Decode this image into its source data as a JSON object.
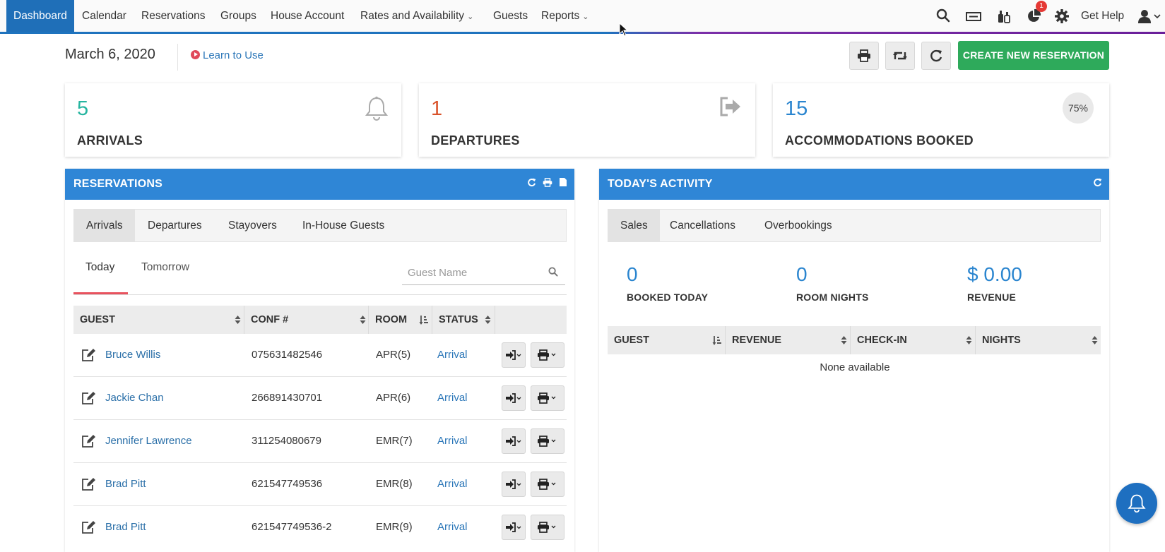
{
  "nav": {
    "items": [
      {
        "label": "Dashboard",
        "active": true
      },
      {
        "label": "Calendar"
      },
      {
        "label": "Reservations"
      },
      {
        "label": "Groups"
      },
      {
        "label": "House Account"
      },
      {
        "label": "Rates and Availability",
        "dropdown": true
      },
      {
        "label": "Guests"
      },
      {
        "label": "Reports",
        "dropdown": true
      }
    ],
    "notification_count": "1",
    "help_label": "Get Help",
    "icons": [
      "search-icon",
      "card-icon",
      "bottles-icon",
      "pie-chart-icon",
      "gear-icon",
      "user-icon"
    ]
  },
  "header": {
    "date": "March 6, 2020",
    "learn_label": "Learn to Use",
    "create_label": "CREATE NEW RESERVATION"
  },
  "summary": {
    "arrivals": {
      "value": "5",
      "label": "ARRIVALS"
    },
    "departures": {
      "value": "1",
      "label": "DEPARTURES"
    },
    "booked": {
      "value": "15",
      "label": "ACCOMMODATIONS BOOKED",
      "percent": "75%"
    }
  },
  "reservations": {
    "title": "RESERVATIONS",
    "tabs": [
      "Arrivals",
      "Departures",
      "Stayovers",
      "In-House Guests"
    ],
    "subtabs": [
      "Today",
      "Tomorrow"
    ],
    "search_placeholder": "Guest Name",
    "columns": [
      "GUEST",
      "CONF #",
      "ROOM",
      "STATUS"
    ],
    "rows": [
      {
        "guest": "Bruce Willis",
        "conf": "075631482546",
        "room": "APR(5)",
        "status": "Arrival"
      },
      {
        "guest": "Jackie Chan",
        "conf": "266891430701",
        "room": "APR(6)",
        "status": "Arrival"
      },
      {
        "guest": "Jennifer Lawrence",
        "conf": "311254080679",
        "room": "EMR(7)",
        "status": "Arrival"
      },
      {
        "guest": "Brad Pitt",
        "conf": "621547749536",
        "room": "EMR(8)",
        "status": "Arrival"
      },
      {
        "guest": "Brad Pitt",
        "conf": "621547749536-2",
        "room": "EMR(9)",
        "status": "Arrival"
      }
    ]
  },
  "activity": {
    "title": "TODAY'S ACTIVITY",
    "tabs": [
      "Sales",
      "Cancellations",
      "Overbookings"
    ],
    "stats": [
      {
        "value": "0",
        "label": "BOOKED TODAY"
      },
      {
        "value": "0",
        "label": "ROOM NIGHTS"
      },
      {
        "value": "$ 0.00",
        "label": "REVENUE"
      }
    ],
    "columns": [
      "GUEST",
      "REVENUE",
      "CHECK-IN",
      "NIGHTS"
    ],
    "empty_text": "None available"
  },
  "colors": {
    "primary": "#2f86d6",
    "nav_active": "#1f6fb8",
    "create": "#2eaa5b",
    "arrivals": "#26b5a0",
    "departures": "#d9532b",
    "booked": "#2a85cf",
    "link": "#2a6fa8"
  }
}
